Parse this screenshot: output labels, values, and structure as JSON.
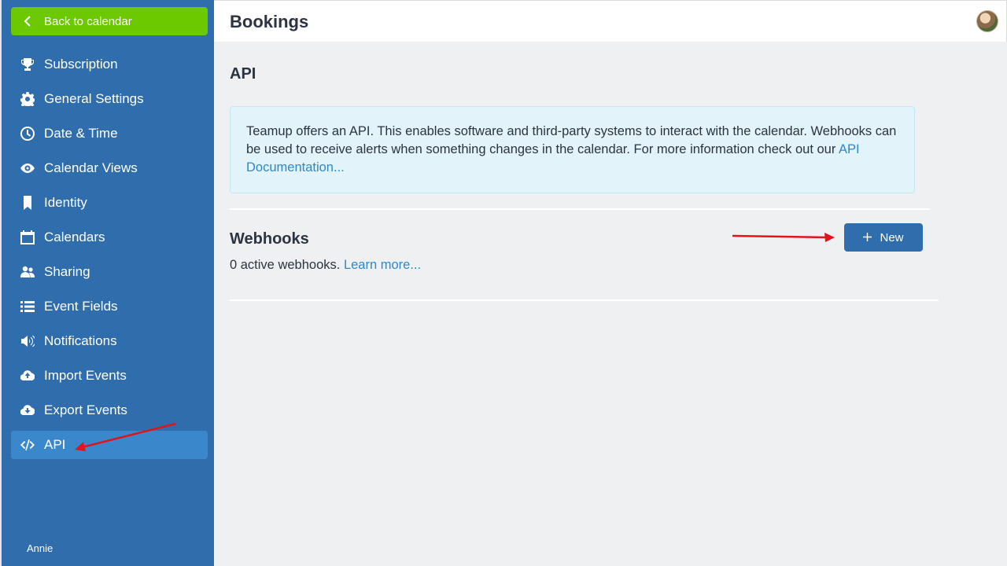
{
  "sidebar": {
    "back_label": "Back to calendar",
    "items": [
      {
        "label": "Subscription",
        "icon": "trophy-icon"
      },
      {
        "label": "General Settings",
        "icon": "gear-icon"
      },
      {
        "label": "Date & Time",
        "icon": "clock-icon"
      },
      {
        "label": "Calendar Views",
        "icon": "eye-icon"
      },
      {
        "label": "Identity",
        "icon": "bookmark-icon"
      },
      {
        "label": "Calendars",
        "icon": "calendar-icon"
      },
      {
        "label": "Sharing",
        "icon": "users-icon"
      },
      {
        "label": "Event Fields",
        "icon": "list-icon"
      },
      {
        "label": "Notifications",
        "icon": "megaphone-icon"
      },
      {
        "label": "Import Events",
        "icon": "cloud-upload-icon"
      },
      {
        "label": "Export Events",
        "icon": "cloud-download-icon"
      },
      {
        "label": "API",
        "icon": "code-icon",
        "active": true
      }
    ],
    "user": "Annie"
  },
  "header": {
    "title": "Bookings"
  },
  "main": {
    "section_title": "API",
    "info_text": "Teamup offers an API. This enables software and third-party systems to interact with the calendar. Webhooks can be used to receive alerts when something changes in the calendar. For more information check out our ",
    "info_link": "API Documentation...",
    "webhooks_title": "Webhooks",
    "webhooks_status": "0 active webhooks.",
    "webhooks_link": "Learn more...",
    "new_button": "New"
  },
  "colors": {
    "sidebar": "#2f6dad",
    "back_button": "#6cc900",
    "active_item": "#3a87cc",
    "link": "#2f88c8",
    "annotation_arrow": "#e0151b"
  }
}
